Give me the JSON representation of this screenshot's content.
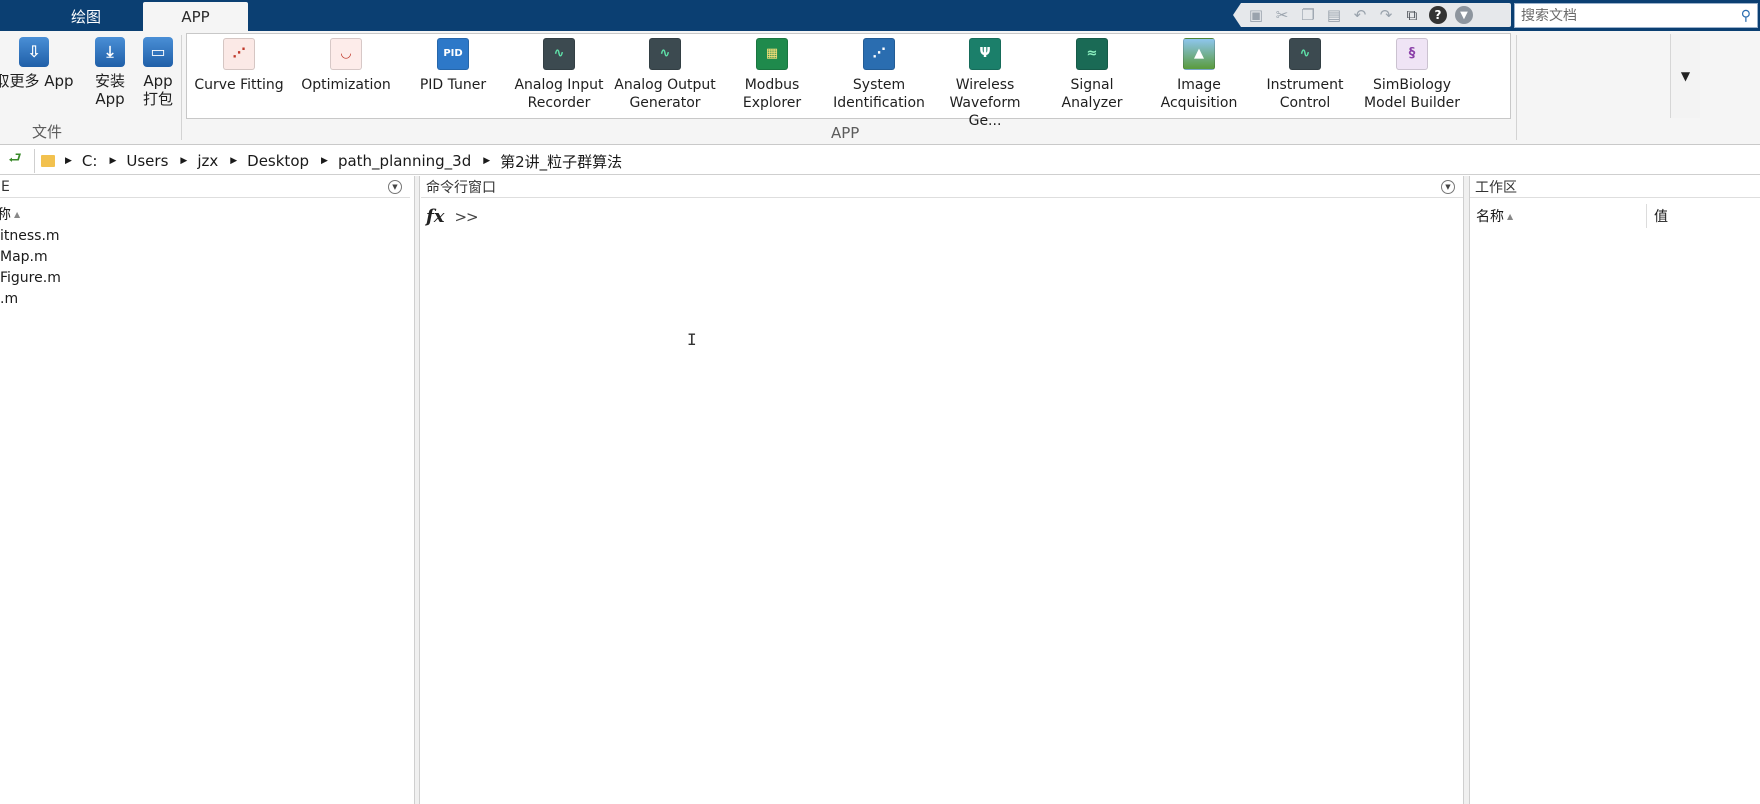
{
  "tabs": [
    {
      "label": "绘图",
      "active": false
    },
    {
      "label": "APP",
      "active": true
    }
  ],
  "quick_access": {
    "icons": [
      "save-icon",
      "cut-icon",
      "copy-icon",
      "paste-icon",
      "undo-icon",
      "redo-icon",
      "switch-windows-icon",
      "help-icon",
      "dropdown-icon"
    ],
    "help_glyph": "?"
  },
  "search": {
    "placeholder": "搜索文档"
  },
  "ribbon": {
    "file_group": {
      "label": "文件",
      "buttons": [
        {
          "line1": "取更多 App",
          "line2": ""
        },
        {
          "line1": "安装",
          "line2": "App"
        },
        {
          "line1": "App",
          "line2": "打包"
        }
      ]
    },
    "apps_group": {
      "label": "APP",
      "apps": [
        {
          "line1": "Curve Fitting",
          "line2": ""
        },
        {
          "line1": "Optimization",
          "line2": ""
        },
        {
          "line1": "PID Tuner",
          "line2": ""
        },
        {
          "line1": "Analog Input",
          "line2": "Recorder"
        },
        {
          "line1": "Analog Output",
          "line2": "Generator"
        },
        {
          "line1": "Modbus",
          "line2": "Explorer"
        },
        {
          "line1": "System",
          "line2": "Identification"
        },
        {
          "line1": "Wireless",
          "line2": "Waveform Ge..."
        },
        {
          "line1": "Signal Analyzer",
          "line2": ""
        },
        {
          "line1": "Image",
          "line2": "Acquisition"
        },
        {
          "line1": "Instrument",
          "line2": "Control"
        },
        {
          "line1": "SimBiology",
          "line2": "Model Builder"
        }
      ],
      "icon_text": {
        "pid": "PID"
      }
    }
  },
  "path": {
    "segments": [
      "C:",
      "Users",
      "jzx",
      "Desktop",
      "path_planning_3d",
      "第2讲_粒子群算法"
    ]
  },
  "left_panel": {
    "title": "E",
    "column_header": "称",
    "sort_glyph": "▲",
    "files": [
      "itness.m",
      "Map.m",
      "Figure.m",
      ".m"
    ]
  },
  "command_window": {
    "title": "命令行窗口",
    "prompt": ">>",
    "fx_glyph": "fx",
    "cursor_glyph": "I"
  },
  "workspace": {
    "title": "工作区",
    "columns": [
      "名称",
      "值"
    ]
  },
  "colors": {
    "titlebar": "#0b3f72",
    "ribbon_bg": "#f5f5f5",
    "accent": "#2a6db0"
  }
}
